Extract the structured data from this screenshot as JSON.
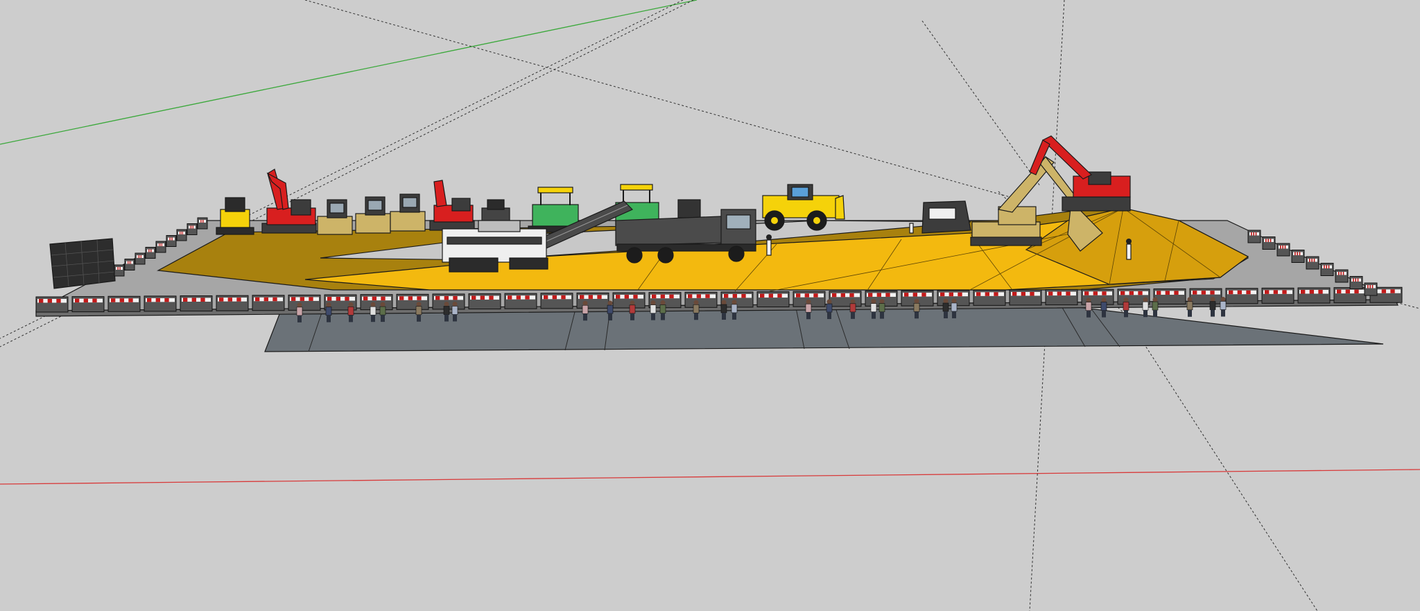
{
  "viewport": {
    "background_color": "#cdcdcd",
    "view_mode": "perspective"
  },
  "axes": {
    "red_axis_color": "#d83a3a",
    "green_axis_color": "#3aa83a",
    "guide_color": "#303030"
  },
  "materials": {
    "platform_surface": "#a6a6a6",
    "walkway_surface": "#6b7278",
    "dirt_dark": "#a8810e",
    "dirt_bright": "#f3b90f",
    "ramp": "#c8c8c8",
    "barrier_red": "#c21b1b",
    "barrier_white": "#f2f2f2",
    "machine_red": "#d81f1f",
    "machine_yellow": "#f5d20a",
    "machine_green": "#3fb35c",
    "machine_tan": "#cdb468",
    "machine_dark": "#3c3c3c",
    "screen_panel": "#2d2d2d"
  },
  "scene_objects": [
    "led-screen",
    "compact-loader",
    "red-excavator-left",
    "road-roller-1",
    "road-roller-2",
    "road-roller-3",
    "red-excavator-mid",
    "compact-machine",
    "green-paver-1",
    "green-paver-2",
    "milling-machine",
    "conveyor-belt",
    "dump-truck",
    "yellow-wheel-loader",
    "crusher-unit",
    "tan-excavator",
    "red-excavator-right",
    "safety-barriers",
    "spectators"
  ]
}
